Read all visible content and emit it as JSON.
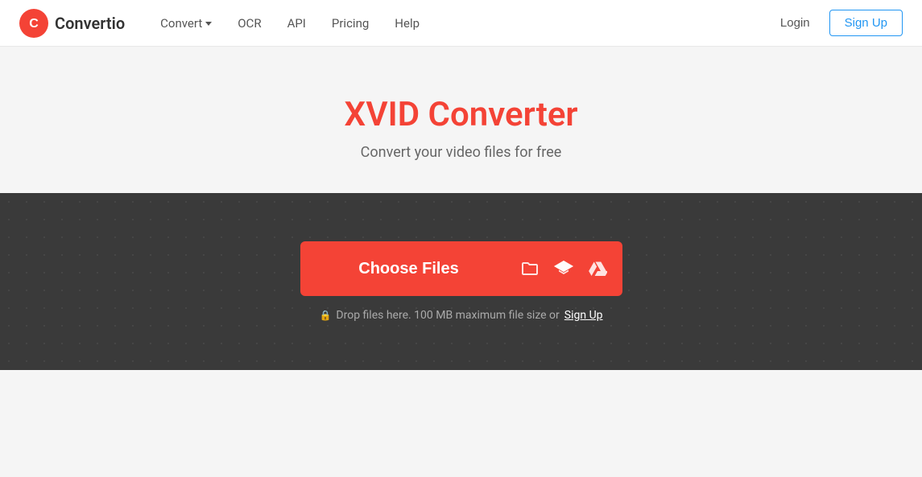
{
  "navbar": {
    "logo_text": "Convertio",
    "nav_items": [
      {
        "label": "Convert",
        "has_dropdown": true
      },
      {
        "label": "OCR",
        "has_dropdown": false
      },
      {
        "label": "API",
        "has_dropdown": false
      },
      {
        "label": "Pricing",
        "has_dropdown": false
      },
      {
        "label": "Help",
        "has_dropdown": false
      }
    ],
    "login_label": "Login",
    "signup_label": "Sign Up"
  },
  "hero": {
    "title": "XVID Converter",
    "subtitle": "Convert your video files for free"
  },
  "dropzone": {
    "choose_files_label": "Choose Files",
    "drop_hint_text": "Drop files here. 100 MB maximum file size or",
    "drop_hint_link": "Sign Up",
    "lock_icon": "🔒"
  }
}
